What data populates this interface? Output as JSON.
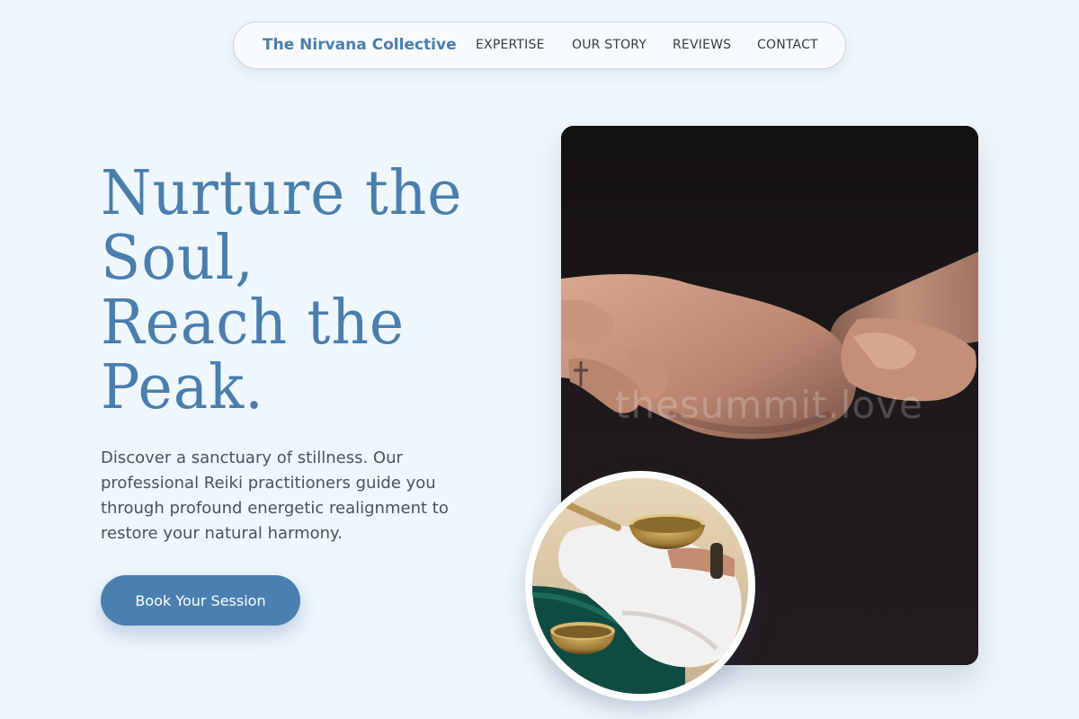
{
  "nav": {
    "brand": "The Nirvana Collective",
    "links": [
      "EXPERTISE",
      "OUR STORY",
      "REVIEWS",
      "CONTACT"
    ]
  },
  "hero": {
    "headline_lines": [
      "Nurture the",
      "Soul,",
      "Reach the",
      "Peak."
    ],
    "description": "Discover a sanctuary of stillness. Our professional Reiki practitioners guide you through profound energetic realignment to restore your natural harmony.",
    "cta_label": "Book Your Session"
  },
  "images": {
    "main_watermark": "thesummit.love",
    "circle_watermark": "thesummit.love"
  },
  "colors": {
    "background": "#eff7fd",
    "accent": "#4a7ead",
    "button": "#4a7fb0",
    "text": "#4a5160"
  }
}
